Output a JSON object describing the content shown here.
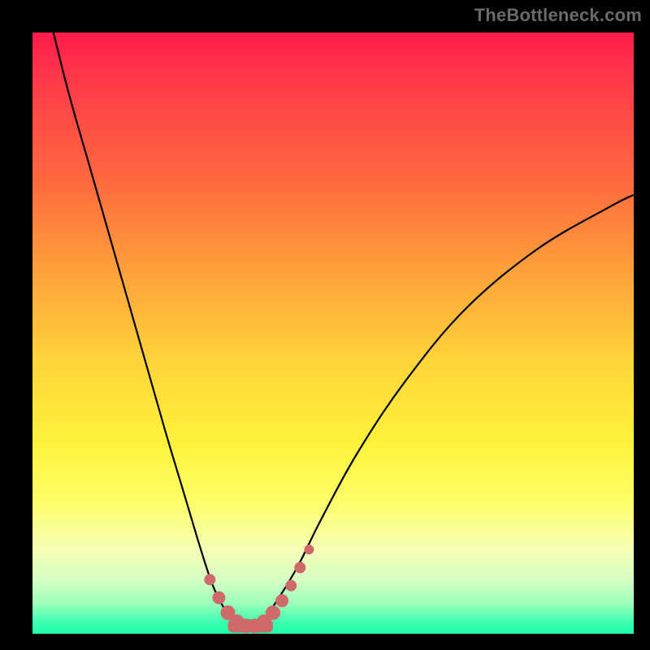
{
  "watermark": "TheBottleneck.com",
  "colors": {
    "frame": "#000000",
    "curve": "#000000",
    "marker": "#cf6a6a",
    "gradient_stops": [
      "#ff1b4a",
      "#ff6a3e",
      "#ffd53a",
      "#fdff68",
      "#d5ffc3",
      "#1fffab"
    ]
  },
  "chart_data": {
    "type": "line",
    "title": "",
    "xlabel": "",
    "ylabel": "",
    "xlim": [
      0,
      100
    ],
    "ylim": [
      0,
      100
    ],
    "grid": false,
    "legend": false,
    "curve": {
      "name": "bottleneck-curve",
      "x": [
        3,
        6,
        10,
        14,
        18,
        22,
        25,
        28,
        30,
        32,
        33.5,
        35,
        36.5,
        38,
        40,
        44,
        48,
        54,
        62,
        72,
        84,
        96,
        100
      ],
      "y": [
        102,
        90,
        76,
        62,
        48,
        34,
        24,
        14,
        8,
        4,
        2,
        1.2,
        1.2,
        2,
        4.5,
        11,
        19,
        30,
        42,
        54,
        64,
        71,
        73
      ]
    },
    "markers": {
      "name": "highlight-points",
      "x": [
        29.5,
        31,
        32.5,
        34,
        35.5,
        37,
        38.5,
        40,
        41.5,
        43,
        44.5,
        46
      ],
      "y": [
        9,
        6,
        3.5,
        2,
        1.3,
        1.3,
        2,
        3.5,
        5.5,
        8,
        11,
        14
      ],
      "r": [
        7,
        8,
        9,
        9,
        9,
        9,
        9,
        9,
        8,
        7,
        7,
        6
      ]
    },
    "flat_segment": {
      "name": "valley-bar",
      "x_start": 32.5,
      "x_end": 40,
      "y": 1.3,
      "thickness": 2.2
    }
  }
}
